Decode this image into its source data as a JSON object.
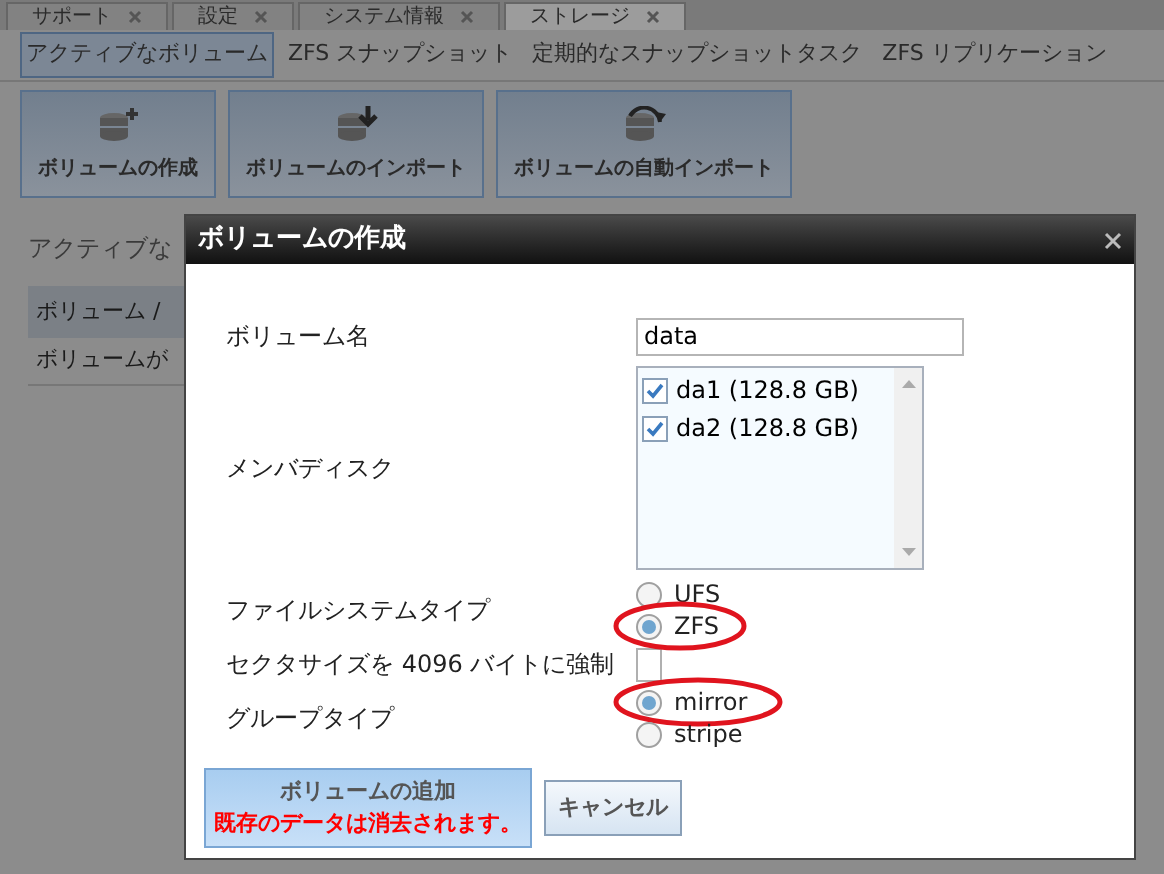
{
  "top_tabs": [
    {
      "label": "サポート",
      "selected": false
    },
    {
      "label": "設定",
      "selected": false
    },
    {
      "label": "システム情報",
      "selected": false
    },
    {
      "label": "ストレージ",
      "selected": true
    }
  ],
  "sub_tabs": [
    {
      "label": "アクティブなボリューム",
      "selected": true
    },
    {
      "label": "ZFS スナップショット",
      "selected": false
    },
    {
      "label": "定期的なスナップショットタスク",
      "selected": false
    },
    {
      "label": "ZFS リプリケーション",
      "selected": false
    }
  ],
  "toolbar": [
    {
      "label": "ボリュームの作成",
      "kind": "create"
    },
    {
      "label": "ボリュームのインポート",
      "kind": "import"
    },
    {
      "label": "ボリュームの自動インポート",
      "kind": "auto"
    }
  ],
  "background": {
    "heading": "アクティブな",
    "table_header": "ボリューム /",
    "table_row": "ボリュームが"
  },
  "dialog": {
    "title": "ボリュームの作成",
    "fields": [
      {
        "kind": "text",
        "label": "ボリューム名",
        "value": "data"
      },
      {
        "kind": "disklist",
        "label": "メンバディスク",
        "items": [
          {
            "label": "da1 (128.8 GB)",
            "checked": true
          },
          {
            "label": "da2 (128.8 GB)",
            "checked": true
          }
        ]
      },
      {
        "kind": "radio",
        "label": "ファイルシステムタイプ",
        "options": [
          {
            "label": "UFS",
            "selected": false,
            "highlighted": false
          },
          {
            "label": "ZFS",
            "selected": true,
            "highlighted": true
          }
        ]
      },
      {
        "kind": "checkbox",
        "label": "セクタサイズを 4096 バイトに強制",
        "checked": false
      },
      {
        "kind": "radio",
        "label": "グループタイプ",
        "options": [
          {
            "label": "mirror",
            "selected": true,
            "highlighted": true
          },
          {
            "label": "stripe",
            "selected": false,
            "highlighted": false
          }
        ]
      }
    ],
    "buttons": [
      {
        "kind": "primary",
        "label": "ボリュームの追加",
        "warning": "既存のデータは消去されます。"
      },
      {
        "kind": "secondary",
        "label": "キャンセル"
      }
    ]
  }
}
